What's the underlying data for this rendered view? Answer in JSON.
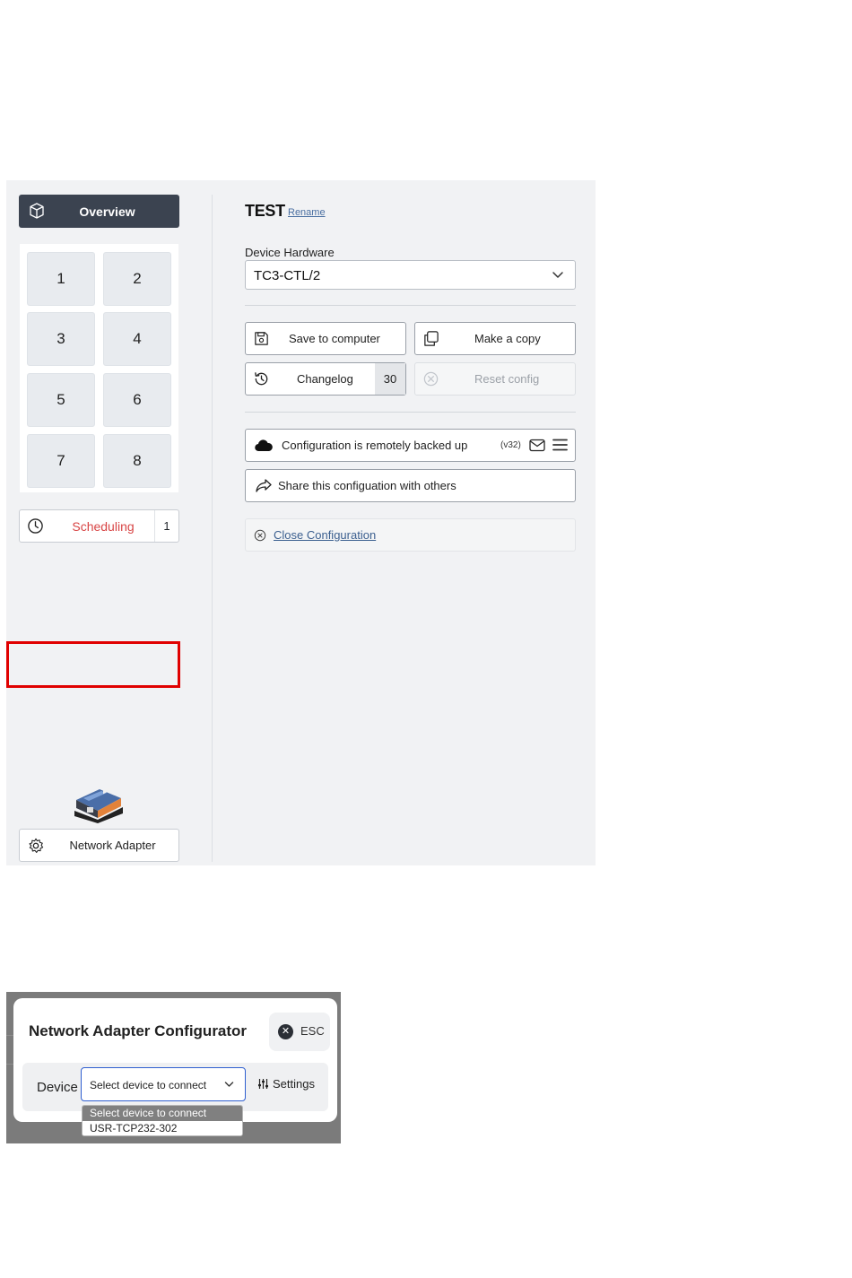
{
  "sidebar": {
    "overview_label": "Overview",
    "grid": [
      "1",
      "2",
      "3",
      "4",
      "5",
      "6",
      "7",
      "8"
    ],
    "scheduling_label": "Scheduling",
    "scheduling_count": "1",
    "network_adapter_label": "Network Adapter"
  },
  "main": {
    "title": "TEST",
    "rename_label": "Rename",
    "device_hardware_label": "Device Hardware",
    "device_hardware_value": "TC3-CTL/2",
    "save_label": "Save to computer",
    "copy_label": "Make a copy",
    "changelog_label": "Changelog",
    "changelog_count": "30",
    "reset_label": "Reset config",
    "backup_label": "Configuration is remotely backed up",
    "backup_version": "(v32)",
    "share_label": "Share this configuation with others",
    "close_label": "Close Configuration"
  },
  "dialog": {
    "title": "Network Adapter Configurator",
    "esc_label": "ESC",
    "device_label": "Device",
    "select_value": "Select device to connect",
    "settings_label": "Settings",
    "options": [
      "Select device to connect",
      "USR-TCP232-302"
    ]
  },
  "colors": {
    "overview_bg": "#3b4350",
    "scheduling_text": "#d84545",
    "highlight_frame": "#e00000",
    "select_focus": "#2f5fd0"
  }
}
